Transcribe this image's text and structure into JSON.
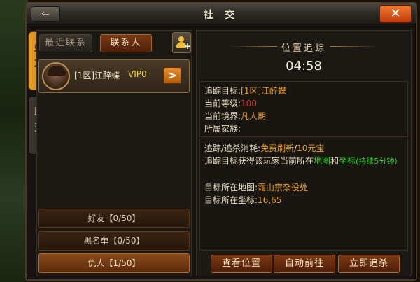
{
  "window": {
    "title": "社 交",
    "back_label": "",
    "close_label": "✕"
  },
  "side_tabs": [
    {
      "label": "好友"
    },
    {
      "label": "聊天"
    }
  ],
  "tabs": {
    "recent": "最近联系",
    "contacts": "联系人"
  },
  "contact": {
    "name": "[1区]江醉蝶",
    "vip": "VIP0",
    "arrow": ">"
  },
  "groups": {
    "friends": "好友【0/50】",
    "blocklist": "黑名单【0/50】",
    "enemies": "仇人【1/50】"
  },
  "tracking": {
    "header": "位置追踪",
    "timer": "04:58",
    "target_label": "追踪目标:",
    "target_value": "[1区]江醉蝶",
    "level_label": "当前等级:",
    "level_value": "100",
    "realm_label": "当前境界:",
    "realm_value": "凡人期",
    "clan_label": "所属家族:",
    "clan_value": "",
    "cost_label": "追踪/追杀消耗:",
    "cost_free": "免费刷新",
    "cost_sep": "/",
    "cost_gold": "10元宝",
    "desc_prefix": "追踪目标获得该玩家当前所在",
    "desc_map": "地图",
    "desc_and": "和",
    "desc_coord": "坐标",
    "desc_duration": "(持续5分钟)",
    "map_label": "目标所在地图:",
    "map_value": "霜山宗杂役处",
    "coord_label": "目标所在坐标:",
    "coord_value": "16,65"
  },
  "actions": {
    "view": "查看位置",
    "auto": "自动前往",
    "chase": "立即追杀"
  },
  "colors": {
    "accent": "#e8a020",
    "level": "#e03020",
    "highlight": "#30d030"
  }
}
